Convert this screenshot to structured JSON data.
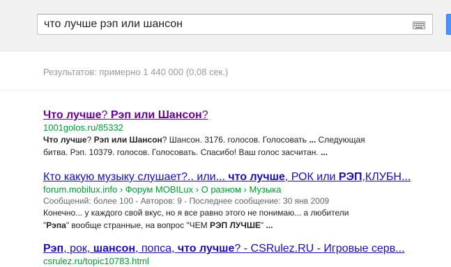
{
  "search": {
    "query": "что лучше рэп или шансон"
  },
  "stats": "Результатов: примерно 1 440 000 (0,08 сек.)",
  "results": [
    {
      "title": [
        {
          "t": "Что лучше",
          "b": true
        },
        {
          "t": "? ",
          "b": false
        },
        {
          "t": "Рэп или Шансон",
          "b": true
        },
        {
          "t": "?",
          "b": false
        }
      ],
      "url": "1001golos.ru/85332",
      "snippet": [
        [
          {
            "t": "Что лучше",
            "b": true
          },
          {
            "t": "? ",
            "b": false
          },
          {
            "t": "Рэп или Шансон",
            "b": true
          },
          {
            "t": "? Шансон. 3176. голосов. Голосовать ",
            "b": false
          },
          {
            "t": "...",
            "b": true
          },
          {
            "t": " Следующая",
            "b": false
          }
        ],
        [
          {
            "t": "битва. Рэп. 10379. голосов. Голосовать. Спасибо! Ваш голос засчитан. ",
            "b": false
          },
          {
            "t": "...",
            "b": true
          }
        ]
      ]
    },
    {
      "title": [
        {
          "t": "Кто какую музыку слушает?.. или... ",
          "b": false
        },
        {
          "t": "что лучше",
          "b": true
        },
        {
          "t": ", РОК или ",
          "b": false
        },
        {
          "t": "РЭП",
          "b": true
        },
        {
          "t": ",КЛУБН...",
          "b": false
        }
      ],
      "url": "forum.mobilux.info › Форум MOBILux › О разном › Музыка",
      "meta": "Сообщений: более 100 - Авторов: 9 - Последнее сообщение: 30 янв 2009",
      "snippet": [
        [
          {
            "t": "Конечно... у каждого свой вкус, но я все равно этого не понимаю... а любители",
            "b": false
          }
        ],
        [
          {
            "t": "\"",
            "b": false
          },
          {
            "t": "Рэпа",
            "b": true
          },
          {
            "t": "\" вообще странные, на вопрос \"ЧЕМ ",
            "b": false
          },
          {
            "t": "РЭП ЛУЧШЕ",
            "b": true
          },
          {
            "t": "\" ",
            "b": false
          },
          {
            "t": "...",
            "b": true
          }
        ]
      ]
    },
    {
      "title": [
        {
          "t": "Рэп",
          "b": true
        },
        {
          "t": ", рок, ",
          "b": false
        },
        {
          "t": "шансон",
          "b": true
        },
        {
          "t": ", попса, ",
          "b": false
        },
        {
          "t": "что лучше",
          "b": true
        },
        {
          "t": "? - CSRulez.RU - Игровые серв...",
          "b": false
        }
      ],
      "url": "csrulez.ru/topic10783.html"
    }
  ]
}
